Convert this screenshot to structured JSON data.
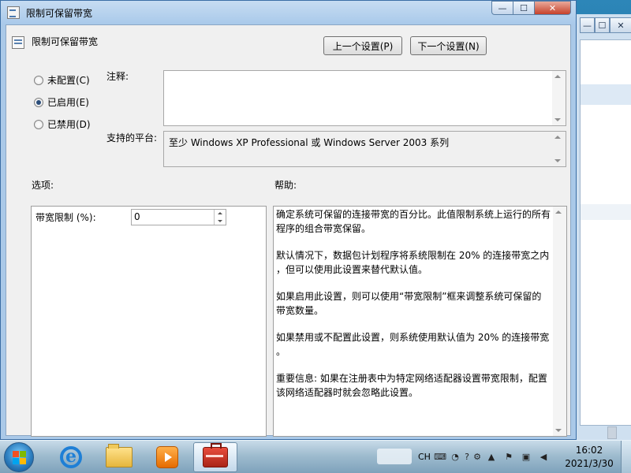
{
  "window": {
    "title": "限制可保留带宽",
    "controls": {
      "minimize": "—",
      "maximize": "☐",
      "close": "✕"
    }
  },
  "header": {
    "title": "限制可保留带宽",
    "prev_button": "上一个设置(P)",
    "next_button": "下一个设置(N)"
  },
  "state_options": [
    {
      "label": "未配置(C)",
      "checked": false
    },
    {
      "label": "已启用(E)",
      "checked": true
    },
    {
      "label": "已禁用(D)",
      "checked": false
    }
  ],
  "comment": {
    "label": "注释:",
    "value": ""
  },
  "platform": {
    "label": "支持的平台:",
    "value": "至少 Windows XP Professional 或 Windows Server 2003 系列"
  },
  "options": {
    "heading": "选项:",
    "bandwidth_label": "带宽限制 (%):",
    "bandwidth_value": "0"
  },
  "help": {
    "heading": "帮助:",
    "paragraphs": [
      "确定系统可保留的连接带宽的百分比。此值限制系统上运行的所有\n程序的组合带宽保留。",
      "默认情况下，数据包计划程序将系统限制在 20% 的连接带宽之内\n，但可以使用此设置来替代默认值。",
      "如果启用此设置，则可以使用“带宽限制”框来调整系统可保留的\n带宽数量。",
      "如果禁用或不配置此设置，则系统使用默认值为 20% 的连接带宽\n。",
      "重要信息: 如果在注册表中为特定网络适配器设置带宽限制，配置\n该网络适配器时就会忽略此设置。"
    ]
  },
  "taskbar": {
    "language": "CH",
    "time": "16:02",
    "date": "2021/3/30"
  }
}
